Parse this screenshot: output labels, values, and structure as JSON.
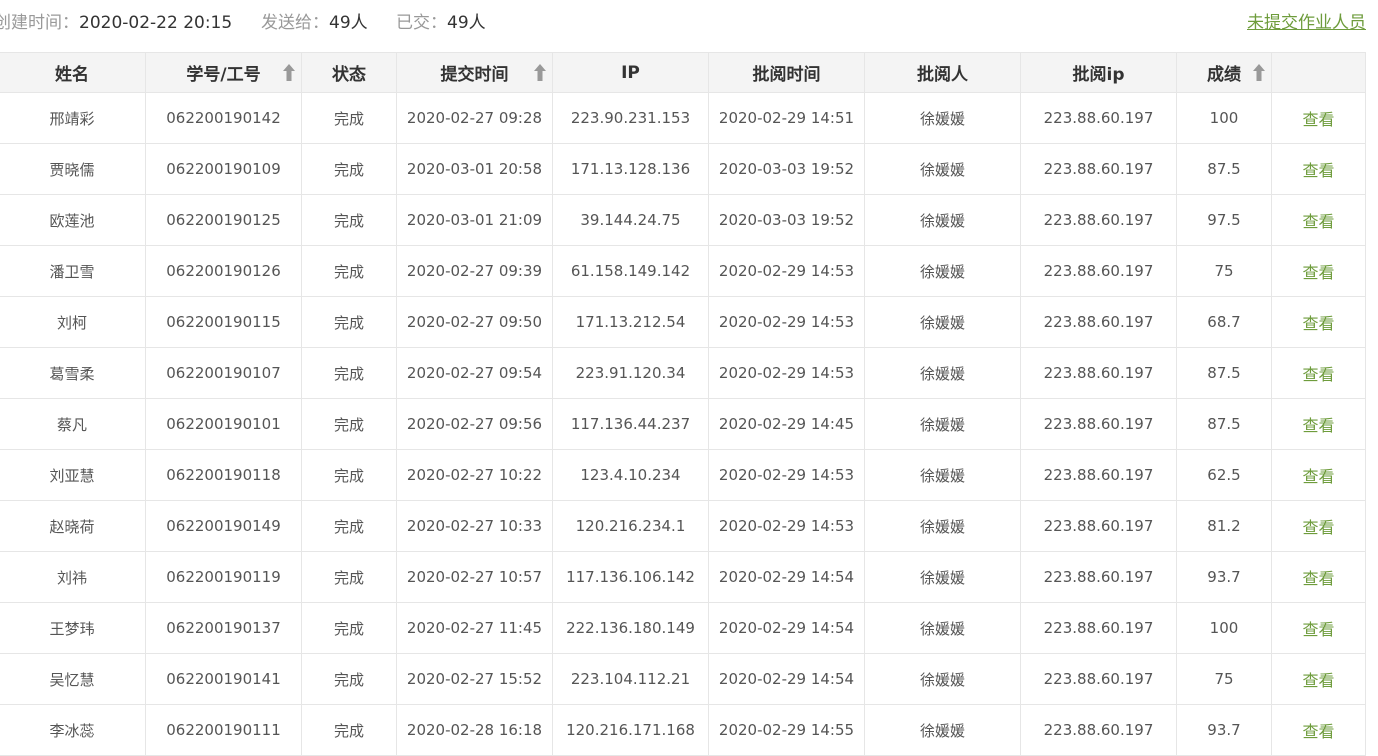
{
  "header": {
    "created_label": "创建时间：",
    "created_value": "2020-02-22 20:15",
    "sent_label": "发送给：",
    "sent_value": "49人",
    "submitted_label": "已交：",
    "submitted_value": "49人",
    "unsubmitted_link": "未提交作业人员"
  },
  "table": {
    "columns": [
      "姓名",
      "学号/工号",
      "状态",
      "提交时间",
      "IP",
      "批阅时间",
      "批阅人",
      "批阅ip",
      "成绩",
      ""
    ],
    "rows": [
      [
        "邢靖彩",
        "062200190142",
        "完成",
        "2020-02-27 09:28",
        "223.90.231.153",
        "2020-02-29 14:51",
        "徐媛媛",
        "223.88.60.197",
        "100",
        "查看"
      ],
      [
        "贾晓儒",
        "062200190109",
        "完成",
        "2020-03-01 20:58",
        "171.13.128.136",
        "2020-03-03 19:52",
        "徐媛媛",
        "223.88.60.197",
        "87.5",
        "查看"
      ],
      [
        "欧莲池",
        "062200190125",
        "完成",
        "2020-03-01 21:09",
        "39.144.24.75",
        "2020-03-03 19:52",
        "徐媛媛",
        "223.88.60.197",
        "97.5",
        "查看"
      ],
      [
        "潘卫雪",
        "062200190126",
        "完成",
        "2020-02-27 09:39",
        "61.158.149.142",
        "2020-02-29 14:53",
        "徐媛媛",
        "223.88.60.197",
        "75",
        "查看"
      ],
      [
        "刘柯",
        "062200190115",
        "完成",
        "2020-02-27 09:50",
        "171.13.212.54",
        "2020-02-29 14:53",
        "徐媛媛",
        "223.88.60.197",
        "68.7",
        "查看"
      ],
      [
        "葛雪柔",
        "062200190107",
        "完成",
        "2020-02-27 09:54",
        "223.91.120.34",
        "2020-02-29 14:53",
        "徐媛媛",
        "223.88.60.197",
        "87.5",
        "查看"
      ],
      [
        "蔡凡",
        "062200190101",
        "完成",
        "2020-02-27 09:56",
        "117.136.44.237",
        "2020-02-29 14:45",
        "徐媛媛",
        "223.88.60.197",
        "87.5",
        "查看"
      ],
      [
        "刘亚慧",
        "062200190118",
        "完成",
        "2020-02-27 10:22",
        "123.4.10.234",
        "2020-02-29 14:53",
        "徐媛媛",
        "223.88.60.197",
        "62.5",
        "查看"
      ],
      [
        "赵晓荷",
        "062200190149",
        "完成",
        "2020-02-27 10:33",
        "120.216.234.1",
        "2020-02-29 14:53",
        "徐媛媛",
        "223.88.60.197",
        "81.2",
        "查看"
      ],
      [
        "刘祎",
        "062200190119",
        "完成",
        "2020-02-27 10:57",
        "117.136.106.142",
        "2020-02-29 14:54",
        "徐媛媛",
        "223.88.60.197",
        "93.7",
        "查看"
      ],
      [
        "王梦玮",
        "062200190137",
        "完成",
        "2020-02-27 11:45",
        "222.136.180.149",
        "2020-02-29 14:54",
        "徐媛媛",
        "223.88.60.197",
        "100",
        "查看"
      ],
      [
        "吴忆慧",
        "062200190141",
        "完成",
        "2020-02-27 15:52",
        "223.104.112.21",
        "2020-02-29 14:54",
        "徐媛媛",
        "223.88.60.197",
        "75",
        "查看"
      ],
      [
        "李冰蕊",
        "062200190111",
        "完成",
        "2020-02-28 16:18",
        "120.216.171.168",
        "2020-02-29 14:55",
        "徐媛媛",
        "223.88.60.197",
        "93.7",
        "查看"
      ]
    ]
  },
  "icons": {
    "sort": "sort-up-arrow-icon"
  },
  "colors": {
    "link": "#6e9c3c",
    "header_bg": "#f4f4f4",
    "border": "#e6e6e6"
  }
}
